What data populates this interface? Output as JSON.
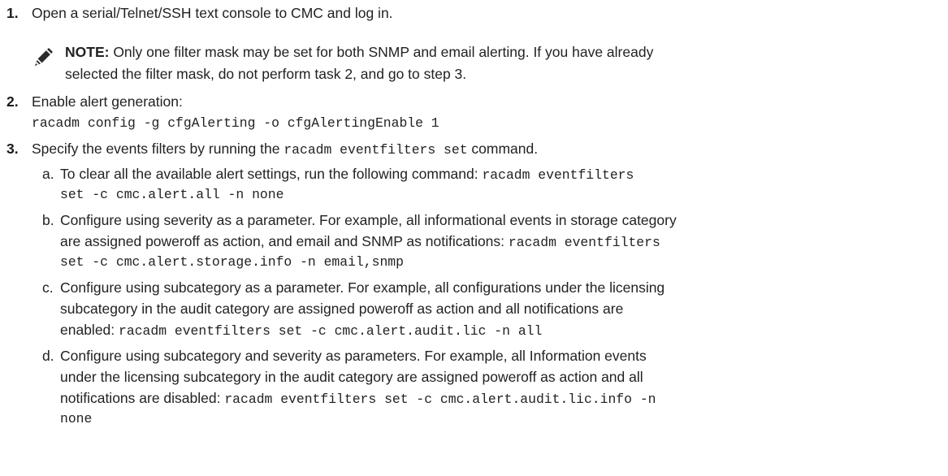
{
  "steps": [
    {
      "number": "1.",
      "text": "Open a serial/Telnet/SSH text console to CMC and log in.",
      "note": {
        "label": "NOTE:",
        "line1": " Only one filter mask may be set for both SNMP and email alerting. If you have already",
        "line2": "selected the filter mask, do not perform task 2, and go to step 3."
      }
    },
    {
      "number": "2.",
      "text": "Enable alert generation:",
      "command": "racadm config -g cfgAlerting -o cfgAlertingEnable 1"
    },
    {
      "number": "3.",
      "text_before": "Specify the events filters by running the ",
      "code": "racadm eventfilters set",
      "text_after": " command.",
      "substeps": [
        {
          "letter": "a.",
          "line1_text": "To clear all the available alert settings, run the following command: ",
          "line1_code": "racadm eventfilters",
          "line2_code": "set -c cmc.alert.all -n none"
        },
        {
          "letter": "b.",
          "line1_text": "Configure using severity as a parameter. For example, all informational events in storage category",
          "line2_text": "are assigned poweroff as action, and email and SNMP as notifications: ",
          "line2_code": "racadm eventfilters",
          "line3_code": "set -c cmc.alert.storage.info -n email,snmp"
        },
        {
          "letter": "c.",
          "line1_text": "Configure using subcategory as a parameter. For example, all configurations under the licensing",
          "line2_text": "subcategory in the audit category are assigned poweroff as action and all notifications are",
          "line3_text": "enabled: ",
          "line3_code": "racadm eventfilters set -c cmc.alert.audit.lic -n all"
        },
        {
          "letter": "d.",
          "line1_text": "Configure using subcategory and severity as parameters. For example, all Information events",
          "line2_text": "under the licensing subcategory in the audit category are assigned poweroff as action and all",
          "line3_text": "notifications are disabled: ",
          "line3_code": "racadm eventfilters set -c cmc.alert.audit.lic.info -n",
          "line4_code": "none"
        }
      ]
    }
  ]
}
